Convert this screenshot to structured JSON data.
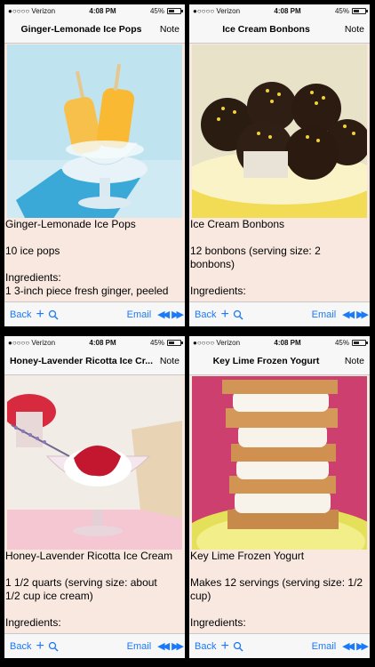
{
  "status": {
    "carrier": "●○○○○ Verizon",
    "time": "4:08 PM",
    "battery": "45%"
  },
  "toolbar": {
    "back": "Back",
    "plus": "+",
    "email": "Email",
    "prev": "◀◀",
    "next": "▶▶"
  },
  "colors": {
    "accent": "#1a7af8",
    "background": "#f8e8e0"
  },
  "recipes": [
    {
      "nav_title": "Ginger-Lemonade Ice Pops",
      "note": "Note",
      "name": "Ginger-Lemonade Ice Pops",
      "yield": "10 ice pops",
      "yield2": "",
      "ingredients_label": "Ingredients:",
      "ingredient1": "1 3-inch piece fresh ginger, peeled"
    },
    {
      "nav_title": "Ice Cream Bonbons",
      "note": "Note",
      "name": "Ice Cream Bonbons",
      "yield": "12 bonbons (serving size: 2",
      "yield2": "bonbons)",
      "ingredients_label": "Ingredients:",
      "ingredient1": ""
    },
    {
      "nav_title": "Honey-Lavender Ricotta Ice Cr...",
      "note": "Note",
      "name": "Honey-Lavender Ricotta Ice Cream",
      "yield": "1 1/2 quarts (serving size: about",
      "yield2": "1/2 cup ice cream)",
      "ingredients_label": "Ingredients:",
      "ingredient1": ""
    },
    {
      "nav_title": "Key Lime Frozen Yogurt",
      "note": "Note",
      "name": "Key Lime Frozen Yogurt",
      "yield": "Makes 12 servings (serving size: 1/2",
      "yield2": "cup)",
      "ingredients_label": "Ingredients:",
      "ingredient1": ""
    }
  ]
}
